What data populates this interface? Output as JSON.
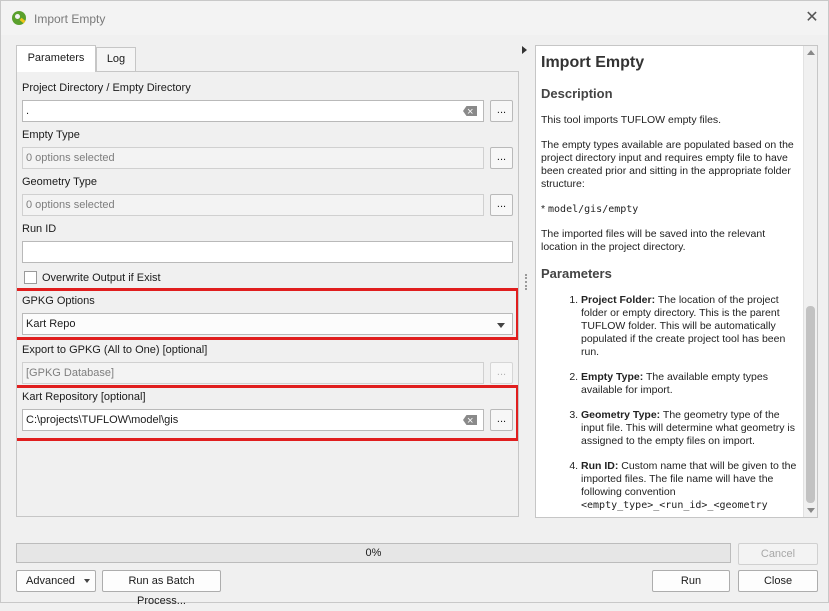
{
  "window": {
    "title": "Import Empty"
  },
  "tabs": [
    {
      "label": "Parameters"
    },
    {
      "label": "Log"
    }
  ],
  "params": {
    "project_dir_label": "Project Directory / Empty Directory",
    "project_dir_value": ".",
    "empty_type_label": "Empty Type",
    "empty_type_value": "0 options selected",
    "geometry_type_label": "Geometry Type",
    "geometry_type_value": "0 options selected",
    "run_id_label": "Run ID",
    "run_id_value": "",
    "overwrite_label": "Overwrite Output if Exist",
    "gpkg_options_label": "GPKG Options",
    "gpkg_options_value": "Kart Repo",
    "export_gpkg_label": "Export to GPKG (All to One) [optional]",
    "export_gpkg_placeholder": "[GPKG Database]",
    "kart_repo_label": "Kart Repository [optional]",
    "kart_repo_value": "C:\\projects\\TUFLOW\\model\\gis",
    "browse_label": "..."
  },
  "help": {
    "title": "Import Empty",
    "description_heading": "Description",
    "description_p1": "This tool imports TUFLOW empty files.",
    "description_p2": "The empty types available are populated based on the project directory input and requires empty file to have been created prior and sitting in the appropriate folder structure:",
    "path_bullet": "*",
    "path": "model/gis/empty",
    "description_p3": "The imported files will be saved into the relevant location in the project directory.",
    "parameters_heading": "Parameters",
    "items": [
      {
        "term": "Project Folder:",
        "text": " The location of the project folder or empty directory. This is the parent TUFLOW folder. This will be automatically populated if the create project tool has been run."
      },
      {
        "term": "Empty Type:",
        "text": " The available empty types available for import."
      },
      {
        "term": "Geometry Type:",
        "text": " The geometry type of the input file. This will determine what geometry is assigned to the empty files on import."
      },
      {
        "term": "Run ID:",
        "text": " Custom name that will be given to the imported files. The file name will have the following convention",
        "code": "<empty_type>_<run_id>_<geometry"
      }
    ]
  },
  "progress": {
    "percent": 0,
    "label": "0%"
  },
  "buttons": {
    "cancel": "Cancel",
    "advanced": "Advanced",
    "batch": "Run as Batch Process...",
    "run": "Run",
    "close": "Close"
  },
  "colors": {
    "highlight": "#e01e1e",
    "qgis_green": "#5aa02c"
  }
}
